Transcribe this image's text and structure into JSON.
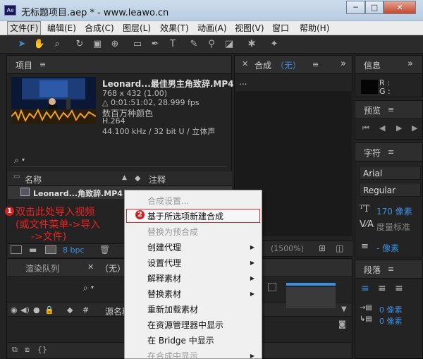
{
  "window": {
    "app_icon_label": "Ae",
    "title": "无标题项目.aep * - www.leawo.cn",
    "buttons": {
      "minimize": "─",
      "maximize": "□",
      "close": "✕"
    }
  },
  "menubar": [
    "文件(F)",
    "编辑(E)",
    "合成(C)",
    "图层(L)",
    "效果(T)",
    "动画(A)",
    "视图(V)",
    "窗口",
    "帮助(H)"
  ],
  "project": {
    "tab_label": "项目",
    "file_name": "Leonard...最佳男主角致辞.MP4",
    "meta": [
      "768 x 432 (1.00)",
      "△ 0:01:51:02, 28.999 fps",
      "数百万种颜色",
      "H.264",
      "44.100 kHz / 32 bit U / 立体声"
    ],
    "col_name": "名称",
    "col_comment": "注释",
    "row_name": "Leonard...角致辞.MP4",
    "bpc": "8 bpc"
  },
  "comp": {
    "tab_label": "合成",
    "tab_value": "（无）",
    "dots": "...",
    "zoom": "(1500%)"
  },
  "info": {
    "title": "信息",
    "r_label": "R :",
    "g_label": "G :"
  },
  "preview": {
    "title": "预览"
  },
  "character": {
    "title": "字符",
    "font_family": "Arial",
    "font_style": "Regular",
    "size": "170 像素",
    "metric": "度量标准",
    "stroke": "- 像素"
  },
  "paragraph": {
    "title": "段落",
    "indent_value_1": "0 像素",
    "indent_value_2": "0 像素"
  },
  "timeline": {
    "tab_render_queue": "渲染队列",
    "tab_none": "（无）",
    "col_hash": "#",
    "col_source": "源名称"
  },
  "context_menu": {
    "items": [
      {
        "label": "合成设置...",
        "disabled": true,
        "arrow": ""
      },
      {
        "label": "基于所选项新建合成",
        "disabled": false,
        "arrow": ""
      },
      {
        "label": "替换为预合成",
        "disabled": true,
        "arrow": ""
      },
      {
        "label": "创建代理",
        "disabled": false,
        "arrow": "▶"
      },
      {
        "label": "设置代理",
        "disabled": false,
        "arrow": "▶"
      },
      {
        "label": "解释素材",
        "disabled": false,
        "arrow": "▶"
      },
      {
        "label": "替换素材",
        "disabled": false,
        "arrow": "▶"
      },
      {
        "label": "重新加载素材",
        "disabled": false,
        "arrow": ""
      },
      {
        "label": "在资源管理器中显示",
        "disabled": false,
        "arrow": ""
      },
      {
        "label": "在 Bridge 中显示",
        "disabled": false,
        "arrow": ""
      },
      {
        "label": "在合成中显示",
        "disabled": true,
        "arrow": "▶"
      }
    ]
  },
  "annotations": {
    "step1_number": "1",
    "step1_lines": [
      "双击此处导入视频",
      "(或文件菜单->导入",
      "->文件)"
    ],
    "step2_number": "2"
  },
  "colors": {
    "accent_blue": "#3d8fe0",
    "annotation_red": "#ee2222"
  }
}
